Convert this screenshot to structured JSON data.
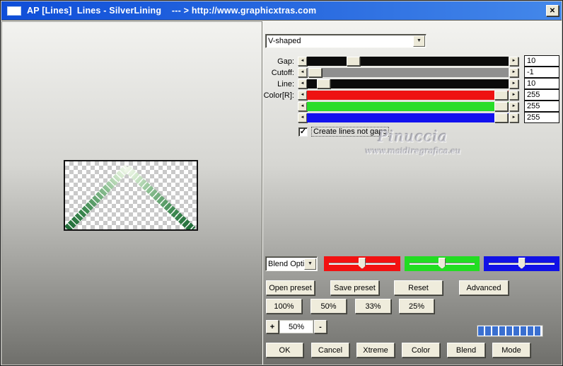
{
  "window": {
    "title": "AP [Lines]  Lines - SilverLining    --- > http://www.graphicxtras.com",
    "close_glyph": "✕"
  },
  "icons": {
    "dropdown_arrow": "▼",
    "left_arrow": "◄",
    "right_arrow": "►",
    "check": "✓"
  },
  "shape_dropdown": {
    "value": "V-shaped"
  },
  "sliders": [
    {
      "label": "Gap:",
      "value": "10",
      "track_color": "#0b0b0b"
    },
    {
      "label": "Cutoff:",
      "value": "-1",
      "track_color": "#8f8f8f"
    },
    {
      "label": "Line:",
      "value": "10",
      "track_color": "#0b0b0b"
    },
    {
      "label": "Color[R]:",
      "value": "255",
      "track_color": "#ee1212"
    },
    {
      "label": "",
      "value": "255",
      "track_color": "#28dd28"
    },
    {
      "label": "",
      "value": "255",
      "track_color": "#1212ee"
    }
  ],
  "checkbox": {
    "label": "Create lines not gaps",
    "checked": true
  },
  "watermark": {
    "line1": "Pinuccia",
    "line2": "www.maidiregrafica.eu"
  },
  "blend": {
    "dropdown_value": "Blend Opti",
    "channel_colors": [
      "#f21111",
      "#22dd22",
      "#1111e6"
    ]
  },
  "preset_buttons": {
    "open": "Open preset",
    "save": "Save preset",
    "reset": "Reset",
    "advanced": "Advanced"
  },
  "percent_buttons": {
    "p100": "100%",
    "p50": "50%",
    "p33": "33%",
    "p25": "25%"
  },
  "zoom_control": {
    "plus": "+",
    "value": "50%",
    "minus": "-"
  },
  "progress": {
    "segments": 9,
    "color": "#3a6fd0"
  },
  "action_buttons": {
    "ok": "OK",
    "cancel": "Cancel",
    "xtreme": "Xtreme",
    "color": "Color",
    "blend": "Blend",
    "mode": "Mode"
  }
}
